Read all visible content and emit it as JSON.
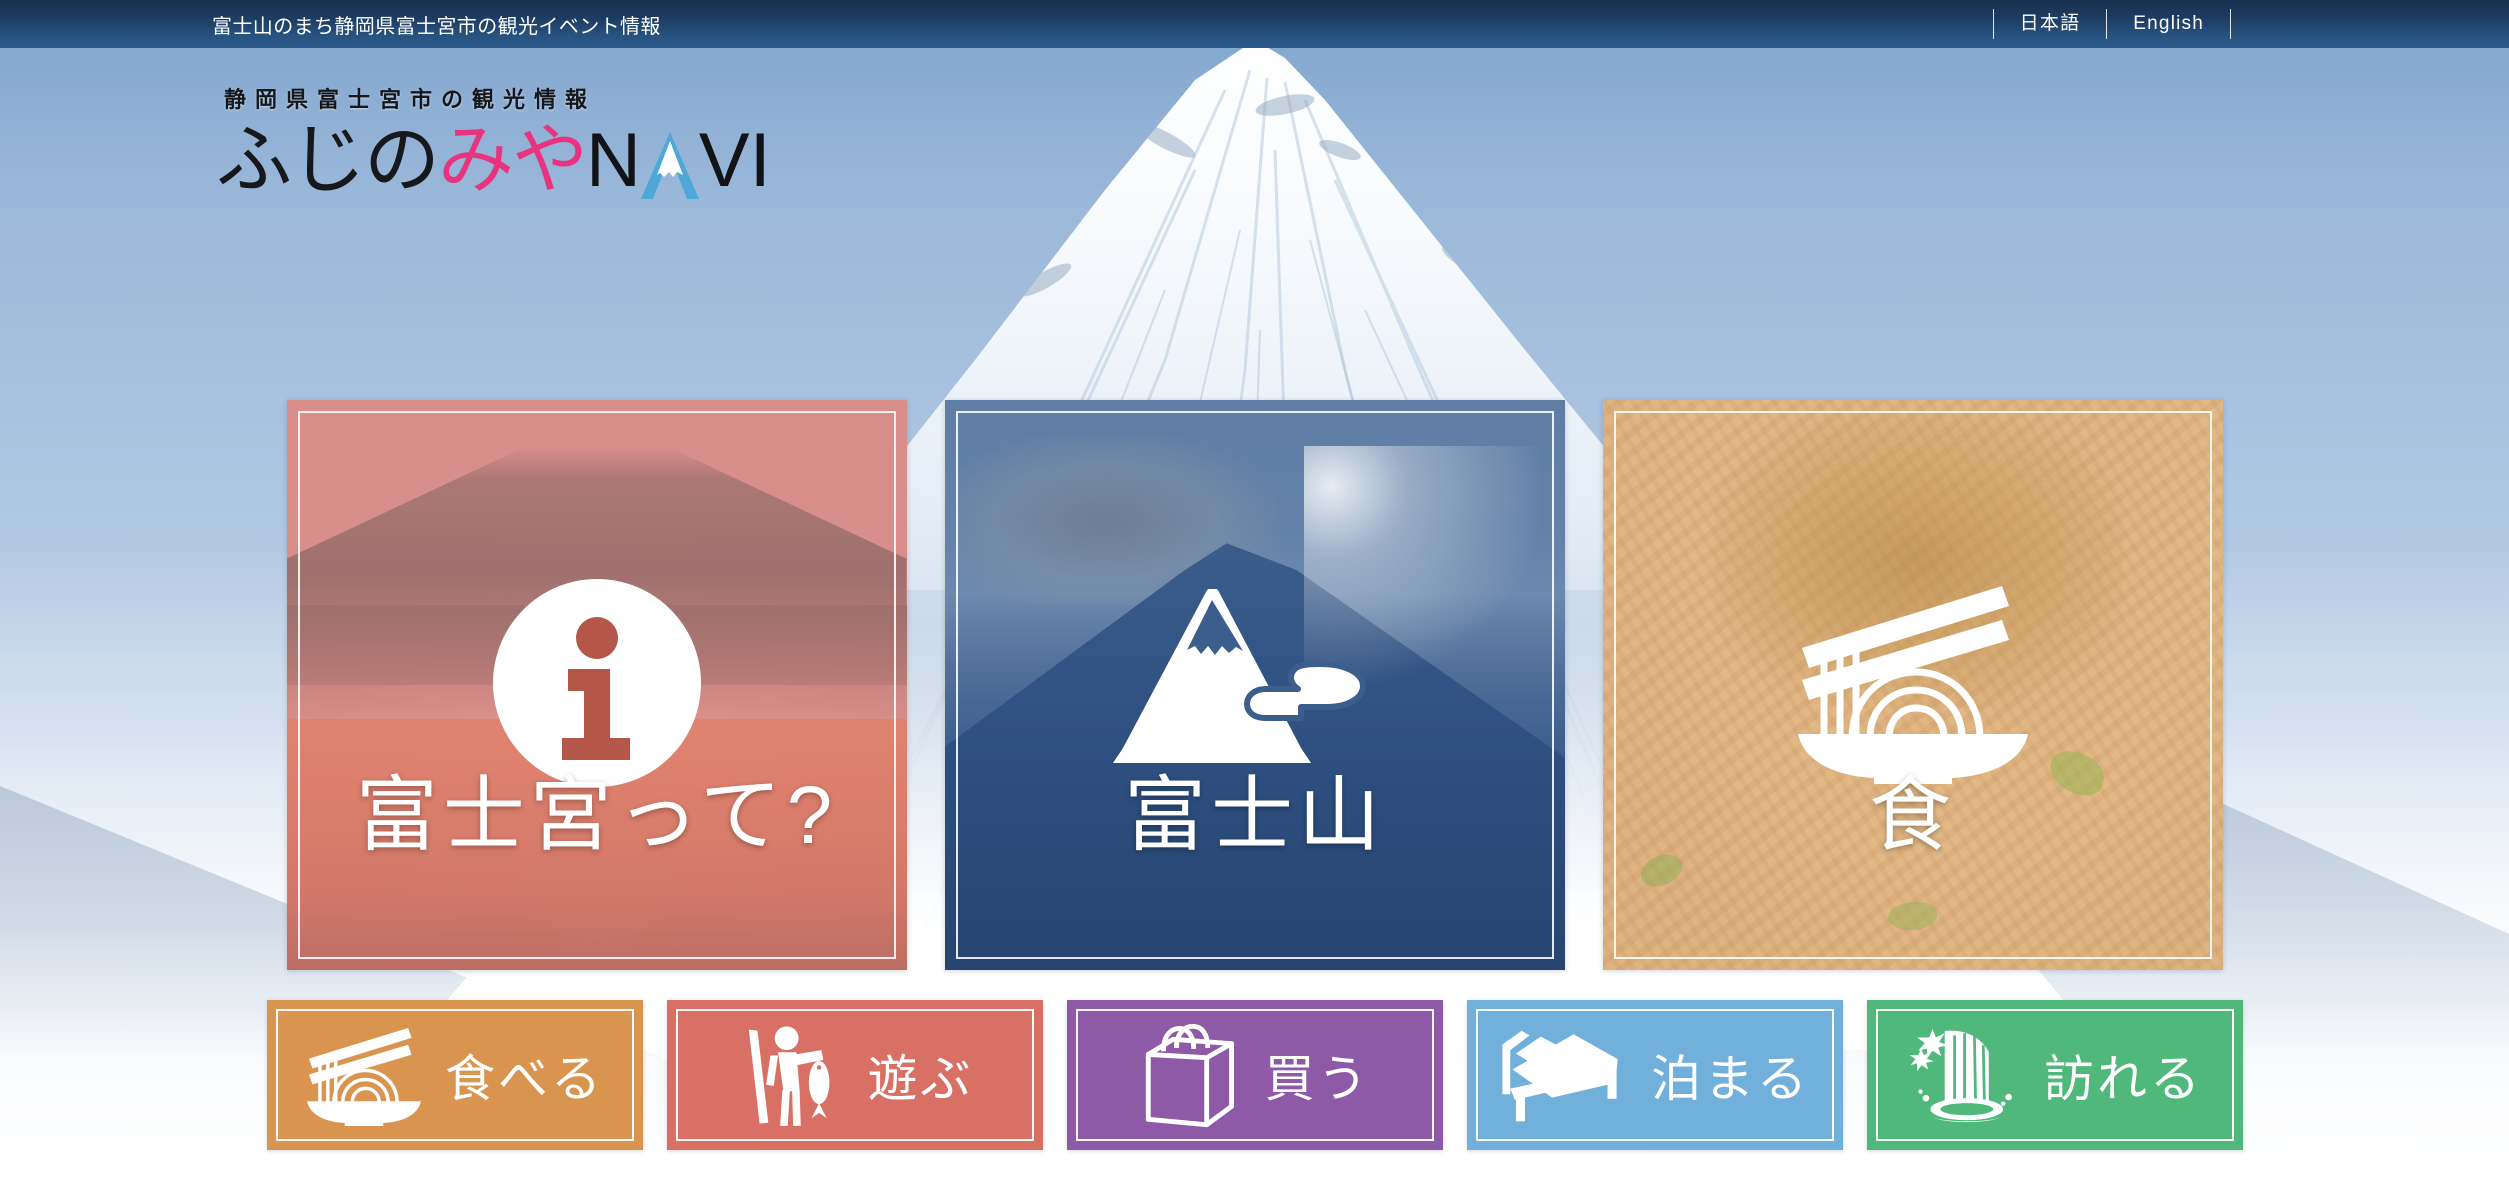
{
  "topbar": {
    "title": "富士山のまち静岡県富士宮市の観光イベント情報",
    "lang_ja": "日本語",
    "lang_en": "English",
    "bg_dark": "#16304f",
    "bg_light": "#2c5a8c"
  },
  "logo": {
    "tagline": "静岡県富士宮市の観光情報",
    "word_1": "ふじの",
    "word_2": "みや",
    "word_3_n": "N",
    "word_3_vi": "VI",
    "pink": "#e8337f",
    "fuji_blue": "#4da8d8"
  },
  "cards": [
    {
      "label": "富士宮って?",
      "icon": "info-circle-icon",
      "theme": "#e9aaac"
    },
    {
      "label": "富士山",
      "icon": "mount-fuji-icon",
      "theme": "#3a5c8c"
    },
    {
      "label": "食",
      "icon": "noodle-bowl-icon",
      "theme": "#d9ab6d"
    }
  ],
  "nav_buttons": [
    {
      "label": "食べる",
      "icon": "noodle-bowl-icon",
      "color": "#d9954f"
    },
    {
      "label": "遊ぶ",
      "icon": "fisherman-icon",
      "color": "#d97065"
    },
    {
      "label": "買う",
      "icon": "shopping-bag-icon",
      "color": "#8e5aa8"
    },
    {
      "label": "泊まる",
      "icon": "bed-icon",
      "color": "#72b0dc"
    },
    {
      "label": "訪れる",
      "icon": "waterfall-icon",
      "color": "#4fb87a"
    }
  ]
}
